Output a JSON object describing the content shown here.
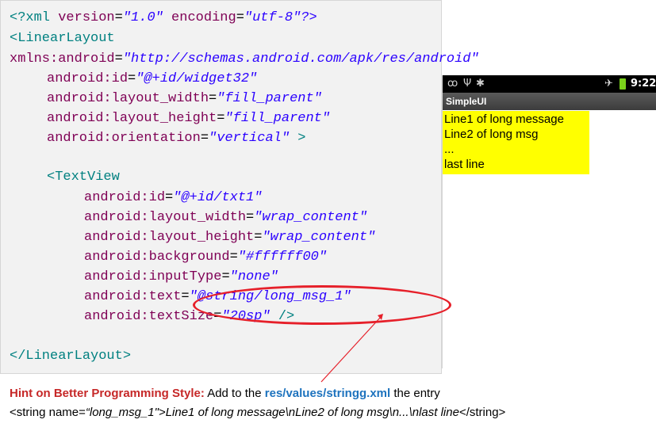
{
  "code": {
    "l1": {
      "tag": "<?xml ",
      "a1": "version",
      "q1": "=",
      "v1": "\"1.0\"",
      "a2": " encoding",
      "q2": "=",
      "v2": "\"utf-8\"?>"
    },
    "l2": "<LinearLayout",
    "l3": {
      "a": "xmlns:android",
      "q": "=",
      "v": "\"http://schemas.android.com/apk/res/android\""
    },
    "l4": {
      "a": "android:id",
      "q": "=",
      "v": "\"@+id/widget32\""
    },
    "l5": {
      "a": "android:layout_width",
      "q": "=",
      "v": "\"fill_parent\""
    },
    "l6": {
      "a": "android:layout_height",
      "q": "=",
      "v": "\"fill_parent\""
    },
    "l7": {
      "a": "android:orientation",
      "q": "=",
      "v": "\"vertical\"",
      "close": " >"
    },
    "l8": "<TextView",
    "l9": {
      "a": "android:id",
      "q": "=",
      "v": "\"@+id/txt1\""
    },
    "l10": {
      "a": "android:layout_width",
      "q": "=",
      "v": "\"wrap_content\""
    },
    "l11": {
      "a": "android:layout_height",
      "q": "=",
      "v": "\"wrap_content\""
    },
    "l12": {
      "a": "android:background",
      "q": "=",
      "v": "\"#ffffff00\""
    },
    "l13": {
      "a": "android:inputType",
      "q": "=",
      "v": "\"none\""
    },
    "l14": {
      "a": "android:text",
      "q": "=",
      "v": "\"@string/long_msg_1\""
    },
    "l15": {
      "a": "android:textSize",
      "q": "=",
      "v": "\"20sp\"",
      "close": " />"
    },
    "l16": "</LinearLayout>"
  },
  "phone": {
    "clock": "9:22",
    "app_title": "SimpleUI",
    "lines": [
      "Line1 of long message",
      "Line2 of long msg",
      "...",
      "last line"
    ],
    "status_icons": [
      "voicemail-icon",
      "usb-icon",
      "debug-icon",
      "airplane-icon",
      "battery-icon"
    ]
  },
  "hint": {
    "label": "Hint on Better Programming Style:",
    "text1": "  Add to the ",
    "path": "res/values/stringg.xml",
    "text2": "  the entry",
    "entry_open": "<string name=",
    "entry_body": "“long_msg_1\">Line1 of long message\\nLine2 of long msg\\n...\\nlast line",
    "entry_close": "</string>"
  },
  "colors": {
    "annotation": "#e6202a",
    "highlight": "#ffff00",
    "hint_label": "#c62828",
    "hint_path": "#1e73be"
  }
}
